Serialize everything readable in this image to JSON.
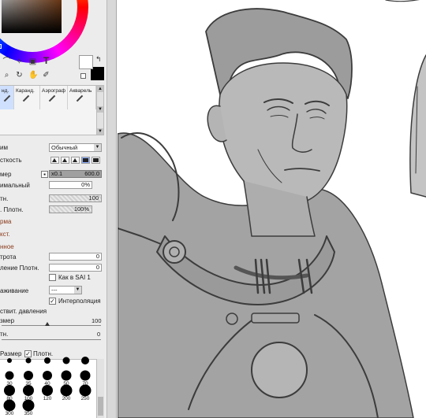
{
  "tool_panel": {
    "brush_tools": [
      "нд.",
      "Каранд.",
      "Аэрограф",
      "Акварель"
    ],
    "selected_brush": "нд.",
    "blend_label": "им",
    "blend_value": "Обычный",
    "hardness_label": "сткость",
    "size_label": "мер",
    "size_multiplier": "x0.1",
    "size_value": "600.0",
    "min_size_label": "имальный",
    "min_size_value": "0%",
    "density_label": "тн.",
    "density_value": "100",
    "density_value_pct": 100,
    "pen_density_label": ". Плотн.",
    "pen_density_value": "100%",
    "pen_density_pct": 100,
    "section_shape": "рма",
    "section_texture": "кст.",
    "section_advanced": "нное",
    "sharpness_label": "трота",
    "sharpness_value": "0",
    "blend_density_label": "ление Плотн.",
    "blend_density_value": "0",
    "sai1_label": "Как в SAI 1",
    "sai1_checked": false,
    "smoothing_label": "аживание",
    "smoothing_value": "---",
    "interpolation_label": "Интерполяция",
    "interpolation_checked": true,
    "pressure_label": "ствит. давления",
    "pressure_size_label": "змер",
    "pressure_size_value": "100",
    "pressure_density_label": "тн.",
    "pressure_density_value": "0",
    "dot_size_label": "Размер",
    "dot_density_label": "Плотн.",
    "dot_density_checked": true,
    "dot_sizes": [
      "",
      "",
      "",
      "",
      "",
      "30",
      "35",
      "40",
      "50",
      "70",
      "80",
      "100",
      "120",
      "200",
      "250",
      "300",
      "350"
    ]
  },
  "colors": {
    "primary": "#ffffff",
    "secondary": "#000000",
    "panel_bg": "#ececec",
    "accent_selected": "#8fb2ff",
    "section_text": "#8a3b1c"
  },
  "icons": [
    "lasso-icon",
    "magic-wand-icon",
    "fill-bucket-icon",
    "text-tool-icon",
    "zoom-icon",
    "rotate-icon",
    "hand-icon",
    "eyedropper-icon"
  ]
}
